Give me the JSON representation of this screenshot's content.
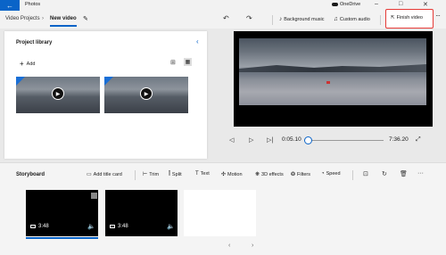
{
  "titlebar": {
    "back_icon": "back-arrow-icon",
    "app_title": "Photos",
    "onedrive_label": "OneDrive",
    "minimize": "–",
    "maximize": "□",
    "close": "✕"
  },
  "toolbar": {
    "breadcrumb_parent": "Video Projects",
    "breadcrumb_sep": "›",
    "breadcrumb_current": "New video",
    "background_music": "Background music",
    "custom_audio": "Custom audio",
    "finish_video": "Finish video",
    "more": "···"
  },
  "library": {
    "title": "Project library",
    "add_label": "Add"
  },
  "preview": {
    "current_time": "0:05.10",
    "end_time": "7:36.20",
    "progress": 0.011
  },
  "storyboard": {
    "title": "Storyboard",
    "tools": {
      "add_title_card": "Add title card",
      "trim": "Trim",
      "split": "Split",
      "text": "Text",
      "motion": "Motion",
      "effects_3d": "3D effects",
      "filters": "Filters",
      "speed": "Speed"
    },
    "clips": [
      {
        "duration": "3:48",
        "selected": true
      },
      {
        "duration": "3:48",
        "selected": false
      }
    ],
    "more": "···"
  }
}
